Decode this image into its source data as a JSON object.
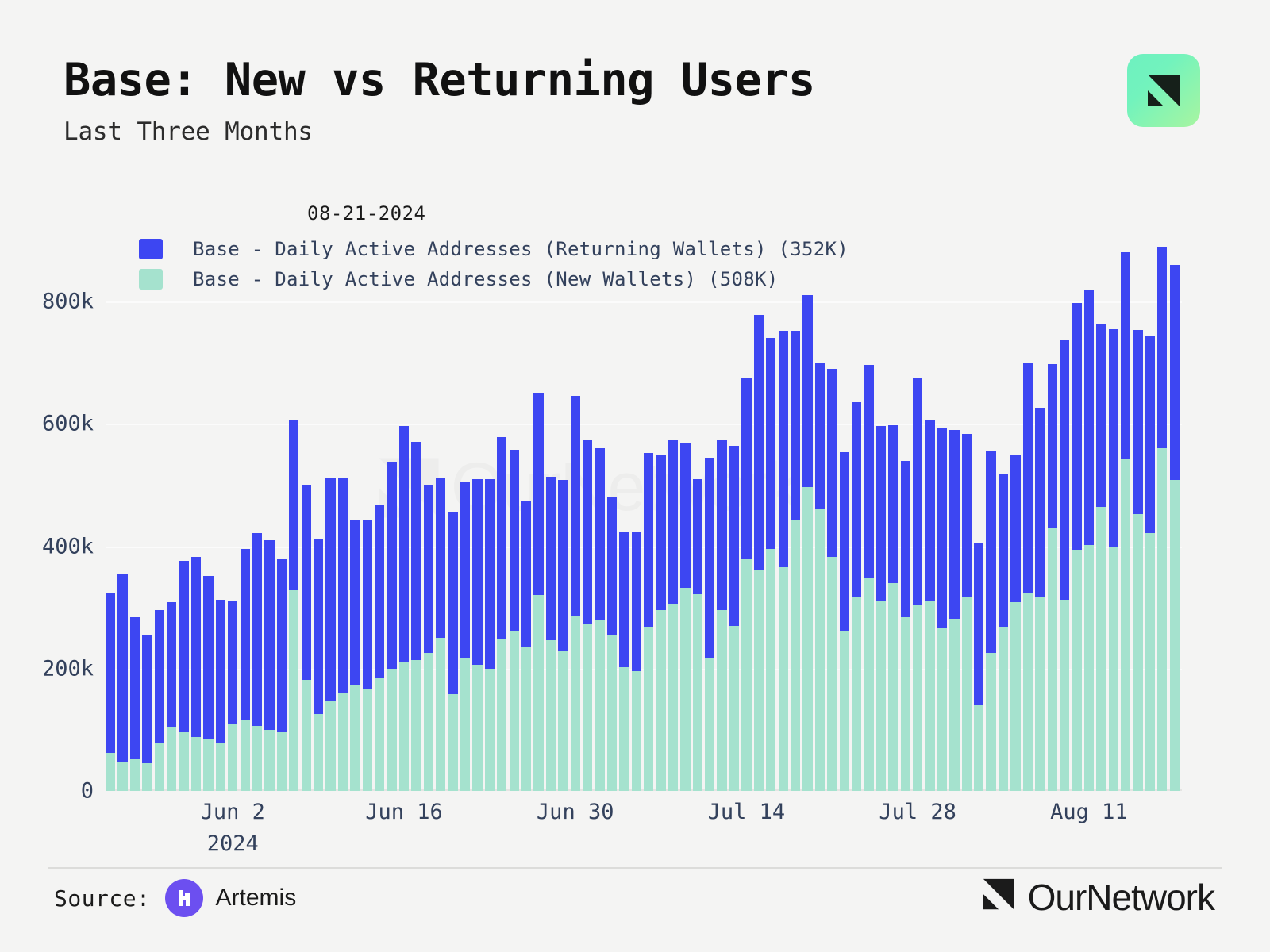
{
  "header": {
    "title": "Base: New vs Returning Users",
    "subtitle": "Last Three Months"
  },
  "badge": {
    "icon": "ournetwork-mark-icon"
  },
  "legend": {
    "date": "08-21-2024",
    "items": [
      {
        "label": "Base - Daily Active Addresses (Returning Wallets) (352K)",
        "color": "#3d46f2",
        "key": "returning"
      },
      {
        "label": "Base - Daily Active Addresses (New Wallets) (508K)",
        "color": "#a5e2ce",
        "key": "new"
      }
    ]
  },
  "footer": {
    "source_label": "Source:",
    "source_name": "Artemis",
    "brand_name": "OurNetwork",
    "watermark": "OurNetwork"
  },
  "chart_data": {
    "type": "bar",
    "subtype": "stacked",
    "title": "Base: New vs Returning Users",
    "subtitle": "Last Three Months",
    "xlabel": "2024",
    "ylabel": "",
    "ylim": [
      0,
      800000
    ],
    "ytick_labels": [
      "0",
      "200k",
      "400k",
      "600k",
      "800k"
    ],
    "ytick_values": [
      0,
      200000,
      400000,
      600000,
      800000
    ],
    "grid": true,
    "legend_position": "top-left",
    "xtick_labels": [
      "Jun 2",
      "Jun 16",
      "Jun 30",
      "Jul 14",
      "Jul 28",
      "Aug 11"
    ],
    "xtick_indices": [
      10,
      24,
      38,
      52,
      66,
      80
    ],
    "series": [
      {
        "name": "Base - Daily Active Addresses (New Wallets)",
        "color": "#a5e2ce",
        "values": [
          62000,
          48000,
          52000,
          46000,
          78000,
          104000,
          96000,
          88000,
          84000,
          78000,
          110000,
          116000,
          106000,
          100000,
          96000,
          328000,
          182000,
          126000,
          148000,
          160000,
          172000,
          166000,
          184000,
          200000,
          212000,
          214000,
          226000,
          250000,
          158000,
          216000,
          206000,
          200000,
          248000,
          262000,
          236000,
          320000,
          246000,
          228000,
          286000,
          272000,
          280000,
          254000,
          202000,
          196000,
          268000,
          296000,
          306000,
          332000,
          322000,
          218000,
          296000,
          270000,
          378000,
          362000,
          396000,
          366000,
          442000,
          496000,
          462000,
          382000,
          262000,
          318000,
          348000,
          310000,
          340000,
          284000,
          304000,
          310000,
          266000,
          282000,
          318000,
          140000,
          226000,
          268000,
          308000,
          324000,
          318000,
          430000,
          312000,
          394000,
          402000,
          464000,
          400000,
          542000,
          452000,
          422000,
          560000,
          508000
        ]
      },
      {
        "name": "Base - Daily Active Addresses (Returning Wallets)",
        "color": "#3d46f2",
        "values": [
          262000,
          306000,
          232000,
          208000,
          218000,
          204000,
          280000,
          294000,
          268000,
          234000,
          200000,
          280000,
          316000,
          310000,
          282000,
          278000,
          318000,
          286000,
          364000,
          352000,
          272000,
          276000,
          284000,
          338000,
          384000,
          356000,
          274000,
          262000,
          298000,
          288000,
          304000,
          310000,
          330000,
          296000,
          238000,
          330000,
          268000,
          280000,
          360000,
          302000,
          280000,
          226000,
          222000,
          228000,
          284000,
          254000,
          268000,
          236000,
          188000,
          326000,
          278000,
          294000,
          296000,
          416000,
          344000,
          386000,
          310000,
          314000,
          238000,
          308000,
          292000,
          318000,
          348000,
          286000,
          258000,
          256000,
          372000,
          296000,
          326000,
          308000,
          266000,
          264000,
          330000,
          250000,
          242000,
          376000,
          308000,
          268000,
          424000,
          404000,
          418000,
          300000,
          354000,
          338000,
          302000,
          322000,
          330000,
          352000
        ]
      }
    ]
  }
}
